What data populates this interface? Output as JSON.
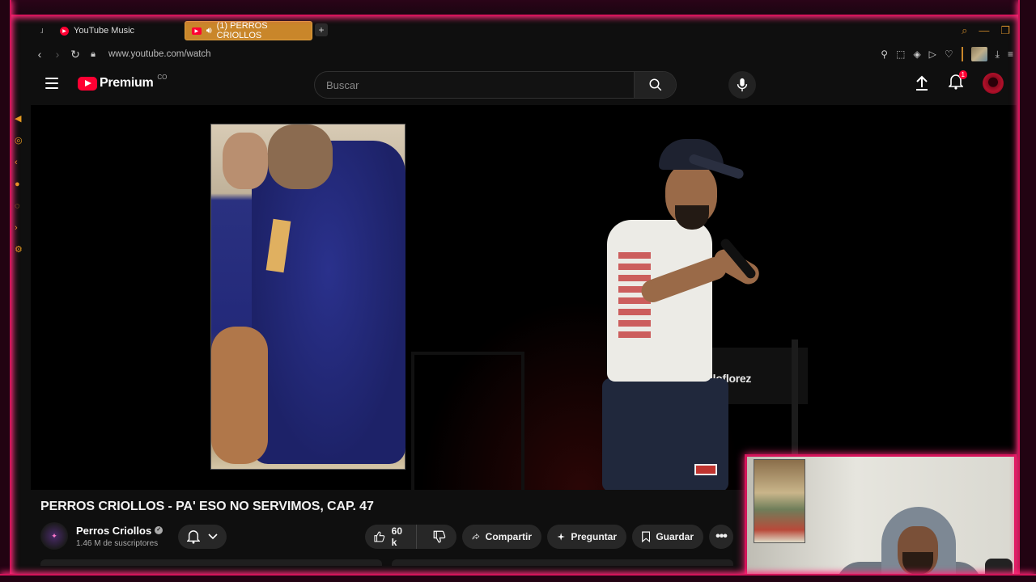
{
  "browser": {
    "tabs": [
      {
        "label": "YouTube Music",
        "active": false
      },
      {
        "label": "(1) PERROS CRIOLLOS",
        "active": true
      }
    ],
    "new_tab_label": "+",
    "url": "www.youtube.com/watch"
  },
  "youtube": {
    "logo_text": "Premium",
    "country_code": "CO",
    "search_placeholder": "Buscar",
    "notification_count": "1"
  },
  "video": {
    "overlay_text": "killoflorez",
    "title": "PERROS CRIOLLOS - PA' ESO NO SERVIMOS, CAP. 47"
  },
  "channel": {
    "name": "Perros Criollos",
    "subscribers": "1.46 M de suscriptores"
  },
  "actions": {
    "likes": "60 k",
    "share": "Compartir",
    "ask": "Preguntar",
    "save": "Guardar"
  },
  "colors": {
    "accent_neon": "#d4145a",
    "yt_red": "#ff0033",
    "active_tab": "#c9862a"
  }
}
